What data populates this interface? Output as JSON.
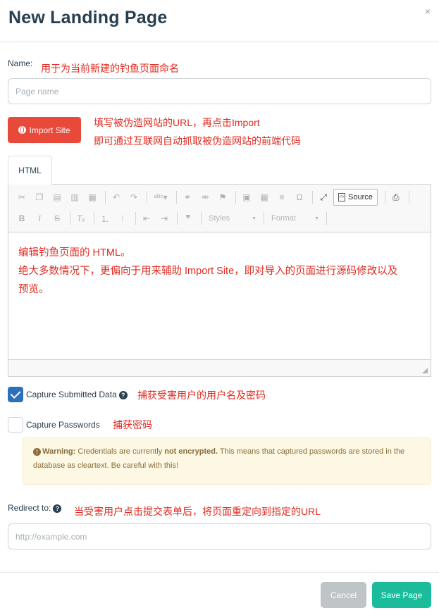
{
  "modal": {
    "title": "New Landing Page",
    "close_glyph": "×"
  },
  "name": {
    "label": "Name:",
    "placeholder": "Page name",
    "value": "",
    "note": "用于为当前新建的钓鱼页面命名"
  },
  "import": {
    "button_label": "Import Site",
    "icon": "globe-icon",
    "note_line1": "填写被伪造网站的URL，再点击Import",
    "note_line2": "即可通过互联网自动抓取被伪造网站的前端代码"
  },
  "editor": {
    "tab_label": "HTML",
    "toolbar": {
      "row1_icons": [
        "cut-icon",
        "copy-icon",
        "paste-icon",
        "paste-text-icon",
        "paste-word-icon",
        "undo-icon",
        "redo-icon",
        "spellcheck-icon",
        "link-icon",
        "unlink-icon",
        "anchor-icon",
        "image-icon",
        "table-icon",
        "horizontal-line-icon",
        "special-char-icon",
        "maximize-icon",
        "preview-icon"
      ],
      "source_label": "Source",
      "row2_icons": [
        "bold-icon",
        "italic-icon",
        "strike-icon",
        "remove-format-icon",
        "numbered-list-icon",
        "bulleted-list-icon",
        "outdent-icon",
        "indent-icon",
        "blockquote-icon"
      ],
      "styles_label": "Styles",
      "format_label": "Format"
    },
    "content_lines": [
      "编辑钓鱼页面的 HTML。",
      "绝大多数情况下，更偏向于用来辅助 Import Site，即对导入的页面进行源码修改以及",
      "预览。"
    ]
  },
  "capture_data": {
    "label": "Capture Submitted Data",
    "checked": true,
    "help_glyph": "?",
    "note": "捕获受害用户的用户名及密码"
  },
  "capture_passwords": {
    "label": "Capture Passwords",
    "checked": false,
    "note": "捕获密码"
  },
  "warning": {
    "icon_glyph": "!",
    "title": "Warning:",
    "text_a": "Credentials are currently",
    "strong": "not encrypted.",
    "text_b": "This means that captured passwords are stored in the database as cleartext. Be careful with this!"
  },
  "redirect": {
    "label": "Redirect to:",
    "help_glyph": "?",
    "placeholder": "http://example.com",
    "value": "",
    "note": "当受害用户点击提交表单后，将页面重定向到指定的URL"
  },
  "footer": {
    "cancel_label": "Cancel",
    "save_label": "Save Page"
  },
  "colors": {
    "import_button": "#e8493b",
    "save_button": "#1abc9c",
    "cancel_button": "#bfc4c7",
    "checkbox_checked": "#2b6fbd",
    "annotation_text": "#e02a20",
    "warning_bg": "#fcf8e3"
  }
}
